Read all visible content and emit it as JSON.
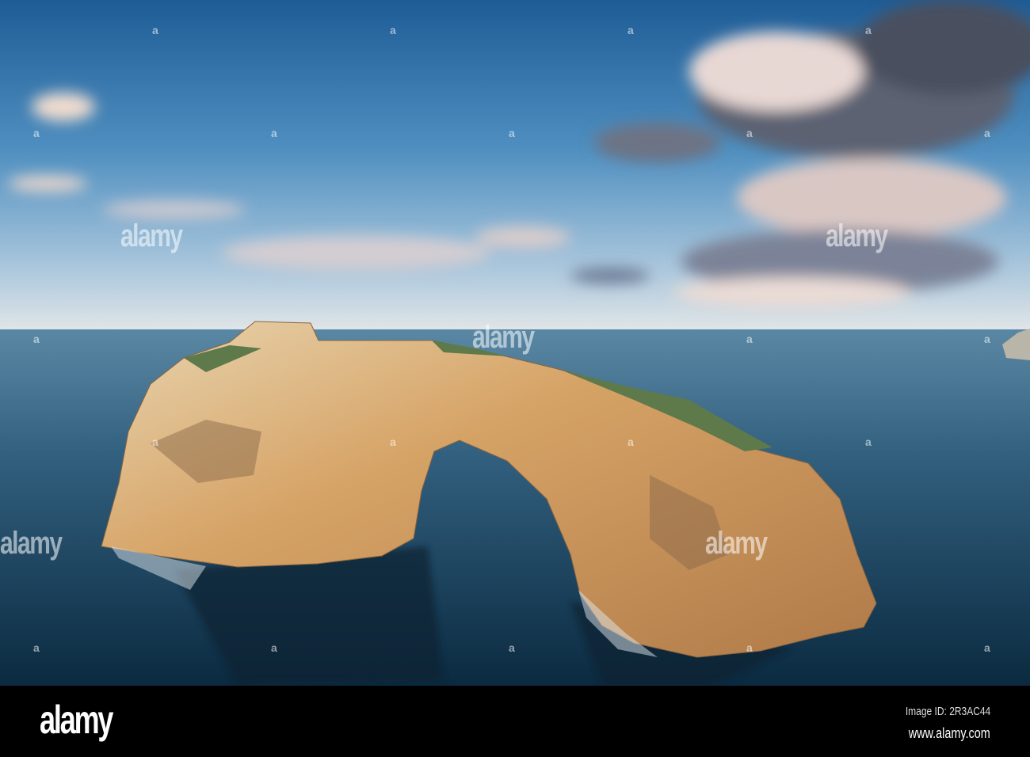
{
  "photo": {
    "subject": "sea-arch",
    "colors": {
      "sky_top": "#1f5f99",
      "sky_horizon": "#d9e2ea",
      "sea_far": "#4d7c98",
      "sea_near": "#0e2f48",
      "rock": "#d9a867"
    }
  },
  "watermark": {
    "text": "alamy",
    "mark": "a"
  },
  "footer": {
    "logo": "alamy",
    "image_id": "Image ID: 2R3AC44",
    "url": "www.alamy.com"
  }
}
